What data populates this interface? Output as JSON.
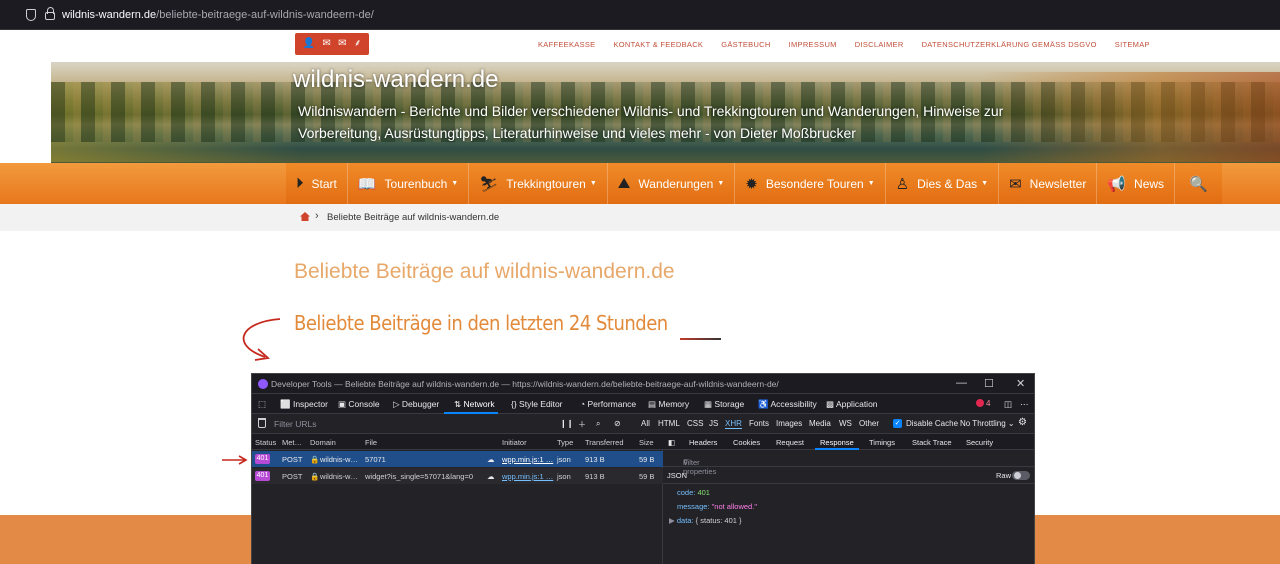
{
  "browser": {
    "url_domain": "wildnis-wandern.de",
    "url_path": "/beliebte-beitraege-auf-wildnis-wandeern-de/"
  },
  "topnav": {
    "social_icons": [
      "user-icon",
      "mail-icon",
      "mail-icon",
      "wheat-icon"
    ],
    "links": [
      "KAFFEEKASSE",
      "KONTAKT & FEEDBACK",
      "GÄSTEBUCH",
      "IMPRESSUM",
      "DISCLAIMER",
      "DATENSCHUTZERKLÄRUNG GEMÄSS DSGVO",
      "SITEMAP"
    ]
  },
  "banner": {
    "title": "wildnis-wandern.de",
    "tagline": "Wildniswandern - Berichte und Bilder verschiedener Wildnis- und Trekkingtouren und Wanderungen, Hinweise zur Vorbereitung, Ausrüstungtipps, Literaturhinweise und vieles mehr - von Dieter Moßbrucker"
  },
  "menu": {
    "items": [
      {
        "label": "Start",
        "icon": "play-icon",
        "dropdown": false
      },
      {
        "label": "Tourenbuch",
        "icon": "book-icon",
        "dropdown": true
      },
      {
        "label": "Trekkingtouren",
        "icon": "hiker-icon",
        "dropdown": true
      },
      {
        "label": "Wanderungen",
        "icon": "mountain-icon",
        "dropdown": true
      },
      {
        "label": "Besondere Touren",
        "icon": "sun-icon",
        "dropdown": true
      },
      {
        "label": "Dies & Das",
        "icon": "person-icon",
        "dropdown": true
      },
      {
        "label": "Newsletter",
        "icon": "envelope-icon",
        "dropdown": false
      },
      {
        "label": "News",
        "icon": "megaphone-icon",
        "dropdown": false
      }
    ],
    "search_icon": "search-icon",
    "color": "#e8771d"
  },
  "breadcrumb": {
    "separator": "›",
    "current": "Beliebte Beiträge auf wildnis-wandern.de"
  },
  "page": {
    "title": "Beliebte Beiträge auf wildnis-wandern.de",
    "subtitle": "Beliebte Beiträge in den letzten 24 Stunden"
  },
  "devtools": {
    "window_title": "Developer Tools — Beliebte Beiträge auf wildnis-wandern.de — https://wildnis-wandern.de/beliebte-beitraege-auf-wildnis-wandeern-de/",
    "tabs": [
      "Inspector",
      "Console",
      "Debugger",
      "Network",
      "Style Editor",
      "Performance",
      "Memory",
      "Storage",
      "Accessibility",
      "Application"
    ],
    "active_tab": "Network",
    "error_count": "4",
    "filter_placeholder": "Filter URLs",
    "type_filters": [
      "All",
      "HTML",
      "CSS",
      "JS",
      "XHR",
      "Fonts",
      "Images",
      "Media",
      "WS",
      "Other"
    ],
    "active_filter": "XHR",
    "disable_cache": "Disable Cache",
    "throttling": "No Throttling",
    "columns": [
      "Status",
      "Met…",
      "Domain",
      "File",
      "Initiator",
      "Type",
      "Transferred",
      "Size"
    ],
    "requests": [
      {
        "status": "401",
        "method": "POST",
        "domain": "wildnis-w…",
        "file": "57071",
        "initiator": "wpp.min.js:1 …",
        "type": "json",
        "transferred": "913 B",
        "size": "59 B"
      },
      {
        "status": "401",
        "method": "POST",
        "domain": "wildnis-w…",
        "file": "widget?is_single=57071&lang=0",
        "initiator": "wpp.min.js:1 …",
        "type": "json",
        "transferred": "913 B",
        "size": "59 B"
      }
    ],
    "detail_tabs": [
      "Headers",
      "Cookies",
      "Request",
      "Response",
      "Timings",
      "Stack Trace",
      "Security"
    ],
    "active_detail_tab": "Response",
    "filter_properties": "Filter properties",
    "json_label": "JSON",
    "raw_label": "Raw",
    "response": {
      "code_key": "code:",
      "code_val": "401",
      "message_key": "message:",
      "message_val": "\"not allowed.\"",
      "data_key": "data:",
      "data_val": "{ status: 401 }"
    }
  }
}
